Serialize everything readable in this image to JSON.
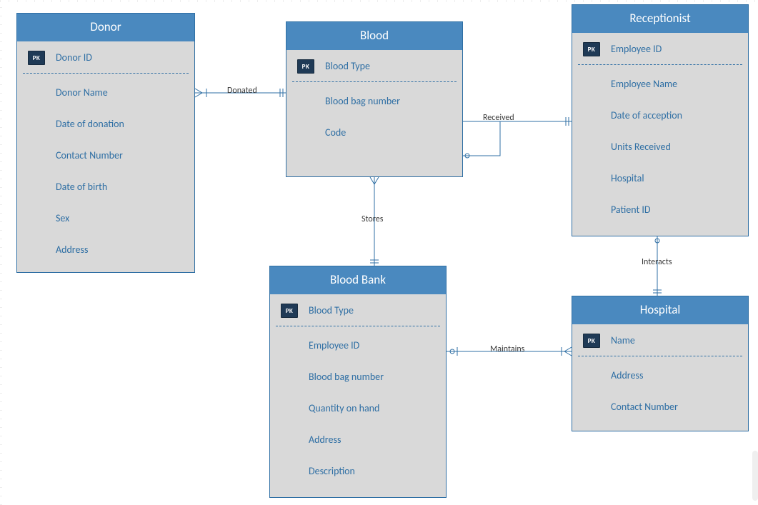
{
  "colors": {
    "header_bg": "#4a89bf",
    "body_bg": "#d9d9d9",
    "text": "#2f6fa4",
    "pk_bg": "#1f3a56",
    "line": "#2f6fa4"
  },
  "entities": {
    "donor": {
      "title": "Donor",
      "pk_label": "PK",
      "attrs": [
        "Donor ID",
        "Donor Name",
        "Date of donation",
        "Contact Number",
        "Date of birth",
        "Sex",
        "Address"
      ]
    },
    "blood": {
      "title": "Blood",
      "pk_label": "PK",
      "attrs": [
        "Blood Type",
        "Blood bag number",
        "Code"
      ]
    },
    "receptionist": {
      "title": "Receptionist",
      "pk_label": "PK",
      "attrs": [
        "Employee ID",
        "Employee Name",
        "Date of acception",
        "Units Received",
        "Hospital",
        "Patient ID"
      ]
    },
    "bloodbank": {
      "title": "Blood Bank",
      "pk_label": "PK",
      "attrs": [
        "Blood Type",
        "Employee ID",
        "Blood bag number",
        "Quantity on hand",
        "Address",
        "Description"
      ]
    },
    "hospital": {
      "title": "Hospital",
      "pk_label": "PK",
      "attrs": [
        "Name",
        "Address",
        "Contact Number"
      ]
    }
  },
  "relationships": {
    "donated": "Donated",
    "received": "Received",
    "stores": "Stores",
    "maintains": "Maintains",
    "interacts": "Interacts"
  },
  "chart_data": {
    "type": "table",
    "description": "Entity-Relationship diagram for a blood-bank/hospital domain",
    "entities": [
      {
        "name": "Donor",
        "primary_key": [
          "Donor ID"
        ],
        "attributes": [
          "Donor ID",
          "Donor Name",
          "Date of donation",
          "Contact Number",
          "Date of birth",
          "Sex",
          "Address"
        ]
      },
      {
        "name": "Blood",
        "primary_key": [
          "Blood Type"
        ],
        "attributes": [
          "Blood Type",
          "Blood bag number",
          "Code"
        ]
      },
      {
        "name": "Receptionist",
        "primary_key": [
          "Employee ID"
        ],
        "attributes": [
          "Employee ID",
          "Employee Name",
          "Date of acception",
          "Units Received",
          "Hospital",
          "Patient ID"
        ]
      },
      {
        "name": "Blood Bank",
        "primary_key": [
          "Blood Type"
        ],
        "attributes": [
          "Blood Type",
          "Employee ID",
          "Blood bag number",
          "Quantity on hand",
          "Address",
          "Description"
        ]
      },
      {
        "name": "Hospital",
        "primary_key": [
          "Name"
        ],
        "attributes": [
          "Name",
          "Address",
          "Contact Number"
        ]
      }
    ],
    "relationships": [
      {
        "from": "Donor",
        "label": "Donated",
        "to": "Blood",
        "notation": "crow's-foot / one-to-many"
      },
      {
        "from": "Blood",
        "label": "Received",
        "to": "Receptionist",
        "notation": "one/zero-to-one"
      },
      {
        "from": "Blood",
        "label": "Stores",
        "to": "Blood Bank",
        "notation": "one-to-one"
      },
      {
        "from": "Blood Bank",
        "label": "Maintains",
        "to": "Hospital",
        "notation": "zero-or-one to one-or-many"
      },
      {
        "from": "Receptionist",
        "label": "Interacts",
        "to": "Hospital",
        "notation": "one-to-zero-or-one"
      }
    ]
  }
}
